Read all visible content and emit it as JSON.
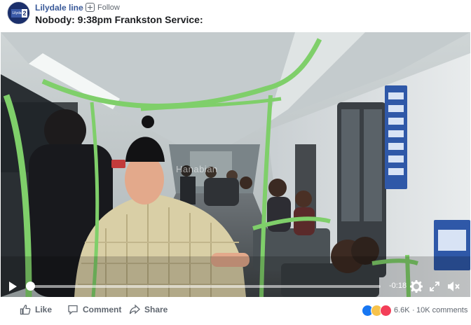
{
  "post": {
    "page_name": "Lilydale line",
    "separator": "·",
    "follow_label": "Follow",
    "title": "Nobody: 9:38pm Frankston Service:",
    "avatar_text": "Lilydale",
    "avatar_number": "2"
  },
  "video": {
    "watermark": "Hanabian",
    "progress": 0.0,
    "time_remaining": "-0:18",
    "icons": [
      "play-icon",
      "gear-icon",
      "fullscreen-icon",
      "volume-mute-icon"
    ]
  },
  "actions": {
    "like_label": "Like",
    "comment_label": "Comment",
    "share_label": "Share"
  },
  "stats": {
    "reaction_count": "6.6K",
    "separator": "·",
    "comment_count": "10K comments",
    "reactions": [
      "like",
      "haha",
      "love"
    ]
  },
  "colors": {
    "link": "#385898",
    "text_secondary": "#606770",
    "like_blue": "#1877f2",
    "love_red": "#f33e58",
    "haha_yellow": "#f7c34c",
    "handrail_green": "#7fcf6a"
  }
}
